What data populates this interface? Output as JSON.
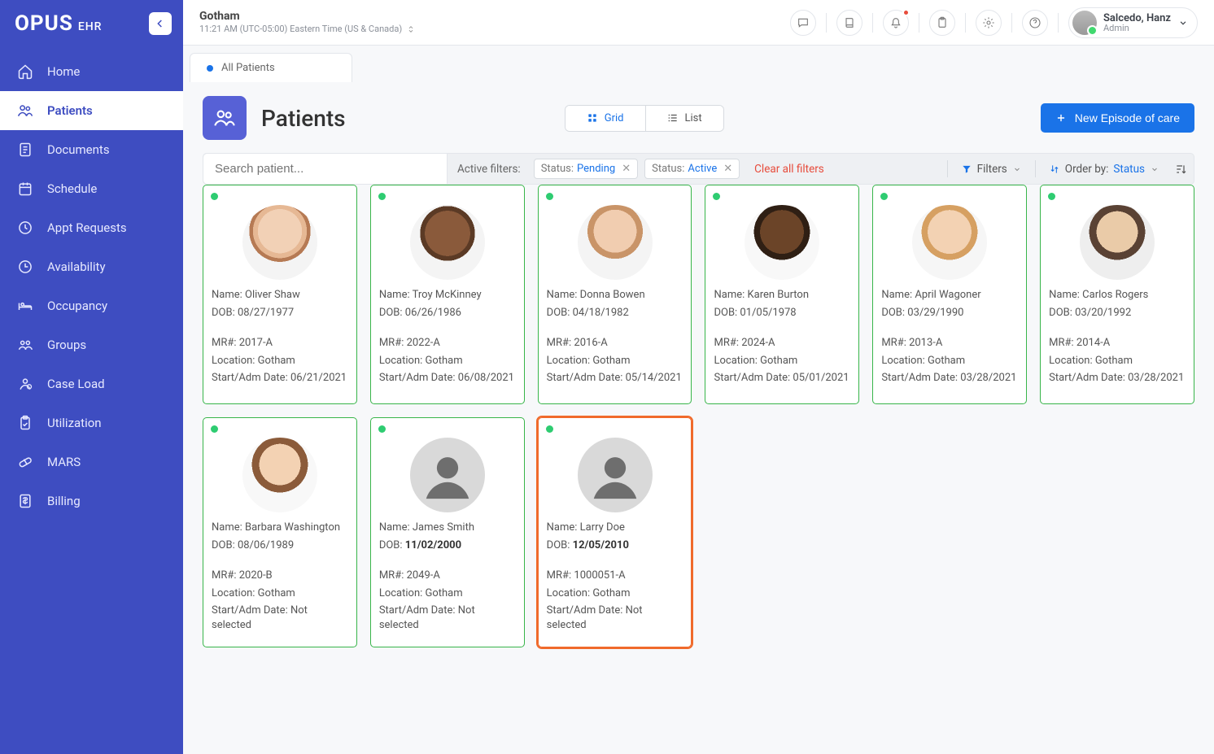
{
  "brand": {
    "name": "OPUS",
    "suffix": "EHR"
  },
  "sidebar": {
    "items": [
      {
        "label": "Home",
        "icon": "home"
      },
      {
        "label": "Patients",
        "icon": "patients"
      },
      {
        "label": "Documents",
        "icon": "documents"
      },
      {
        "label": "Schedule",
        "icon": "schedule"
      },
      {
        "label": "Appt Requests",
        "icon": "clock"
      },
      {
        "label": "Availability",
        "icon": "clock-check"
      },
      {
        "label": "Occupancy",
        "icon": "bed"
      },
      {
        "label": "Groups",
        "icon": "groups"
      },
      {
        "label": "Case Load",
        "icon": "caseload"
      },
      {
        "label": "Utilization",
        "icon": "clipboard"
      },
      {
        "label": "MARS",
        "icon": "pill"
      },
      {
        "label": "Billing",
        "icon": "billing"
      }
    ],
    "active_index": 1
  },
  "topbar": {
    "location": "Gotham",
    "datetime": "11:21 AM (UTC-05:00) Eastern Time (US & Canada)",
    "user": {
      "name": "Salcedo, Hanz",
      "role": "Admin"
    },
    "alert_badge": true
  },
  "tab": {
    "label": "All Patients"
  },
  "page": {
    "title": "Patients",
    "view_grid": "Grid",
    "view_list": "List",
    "primary_btn": "New Episode of care"
  },
  "filterbar": {
    "search_placeholder": "Search patient...",
    "active_label": "Active filters:",
    "chips": [
      {
        "k": "Status:",
        "v": "Pending"
      },
      {
        "k": "Status:",
        "v": "Active"
      }
    ],
    "clear": "Clear all filters",
    "filters": "Filters",
    "orderby_label": "Order by:",
    "orderby_value": "Status"
  },
  "field_labels": {
    "name": "Name: ",
    "dob": "DOB: ",
    "mr": "MR#: ",
    "location": "Location: ",
    "start": "Start/Adm Date: "
  },
  "patients": [
    {
      "name": "Oliver Shaw",
      "dob": "08/27/1977",
      "mr": "2017-A",
      "loc": "Gotham",
      "start": "06/21/2021",
      "face": "face1"
    },
    {
      "name": "Troy McKinney",
      "dob": "06/26/1986",
      "mr": "2022-A",
      "loc": "Gotham",
      "start": "06/08/2021",
      "face": "face2"
    },
    {
      "name": "Donna Bowen",
      "dob": "04/18/1982",
      "mr": "2016-A",
      "loc": "Gotham",
      "start": "05/14/2021",
      "face": "face3"
    },
    {
      "name": "Karen Burton",
      "dob": "01/05/1978",
      "mr": "2024-A",
      "loc": "Gotham",
      "start": "05/01/2021",
      "face": "face4"
    },
    {
      "name": "April Wagoner",
      "dob": "03/29/1990",
      "mr": "2013-A",
      "loc": "Gotham",
      "start": "03/28/2021",
      "face": "face5"
    },
    {
      "name": "Carlos Rogers",
      "dob": "03/20/1992",
      "mr": "2014-A",
      "loc": "Gotham",
      "start": "03/28/2021",
      "face": "face6"
    },
    {
      "name": "Barbara Washington",
      "dob": "08/06/1989",
      "mr": "2020-B",
      "loc": "Gotham",
      "start": "Not selected",
      "face": "face7"
    },
    {
      "name": "James Smith",
      "dob": "11/02/2000",
      "mr": "2049-A",
      "loc": "Gotham",
      "start": "Not selected",
      "face": "placeholder",
      "dob_bold": true
    },
    {
      "name": "Larry Doe",
      "dob": "12/05/2010",
      "mr": "1000051-A",
      "loc": "Gotham",
      "start": "Not selected",
      "face": "placeholder",
      "dob_bold": true,
      "selected": true
    }
  ]
}
